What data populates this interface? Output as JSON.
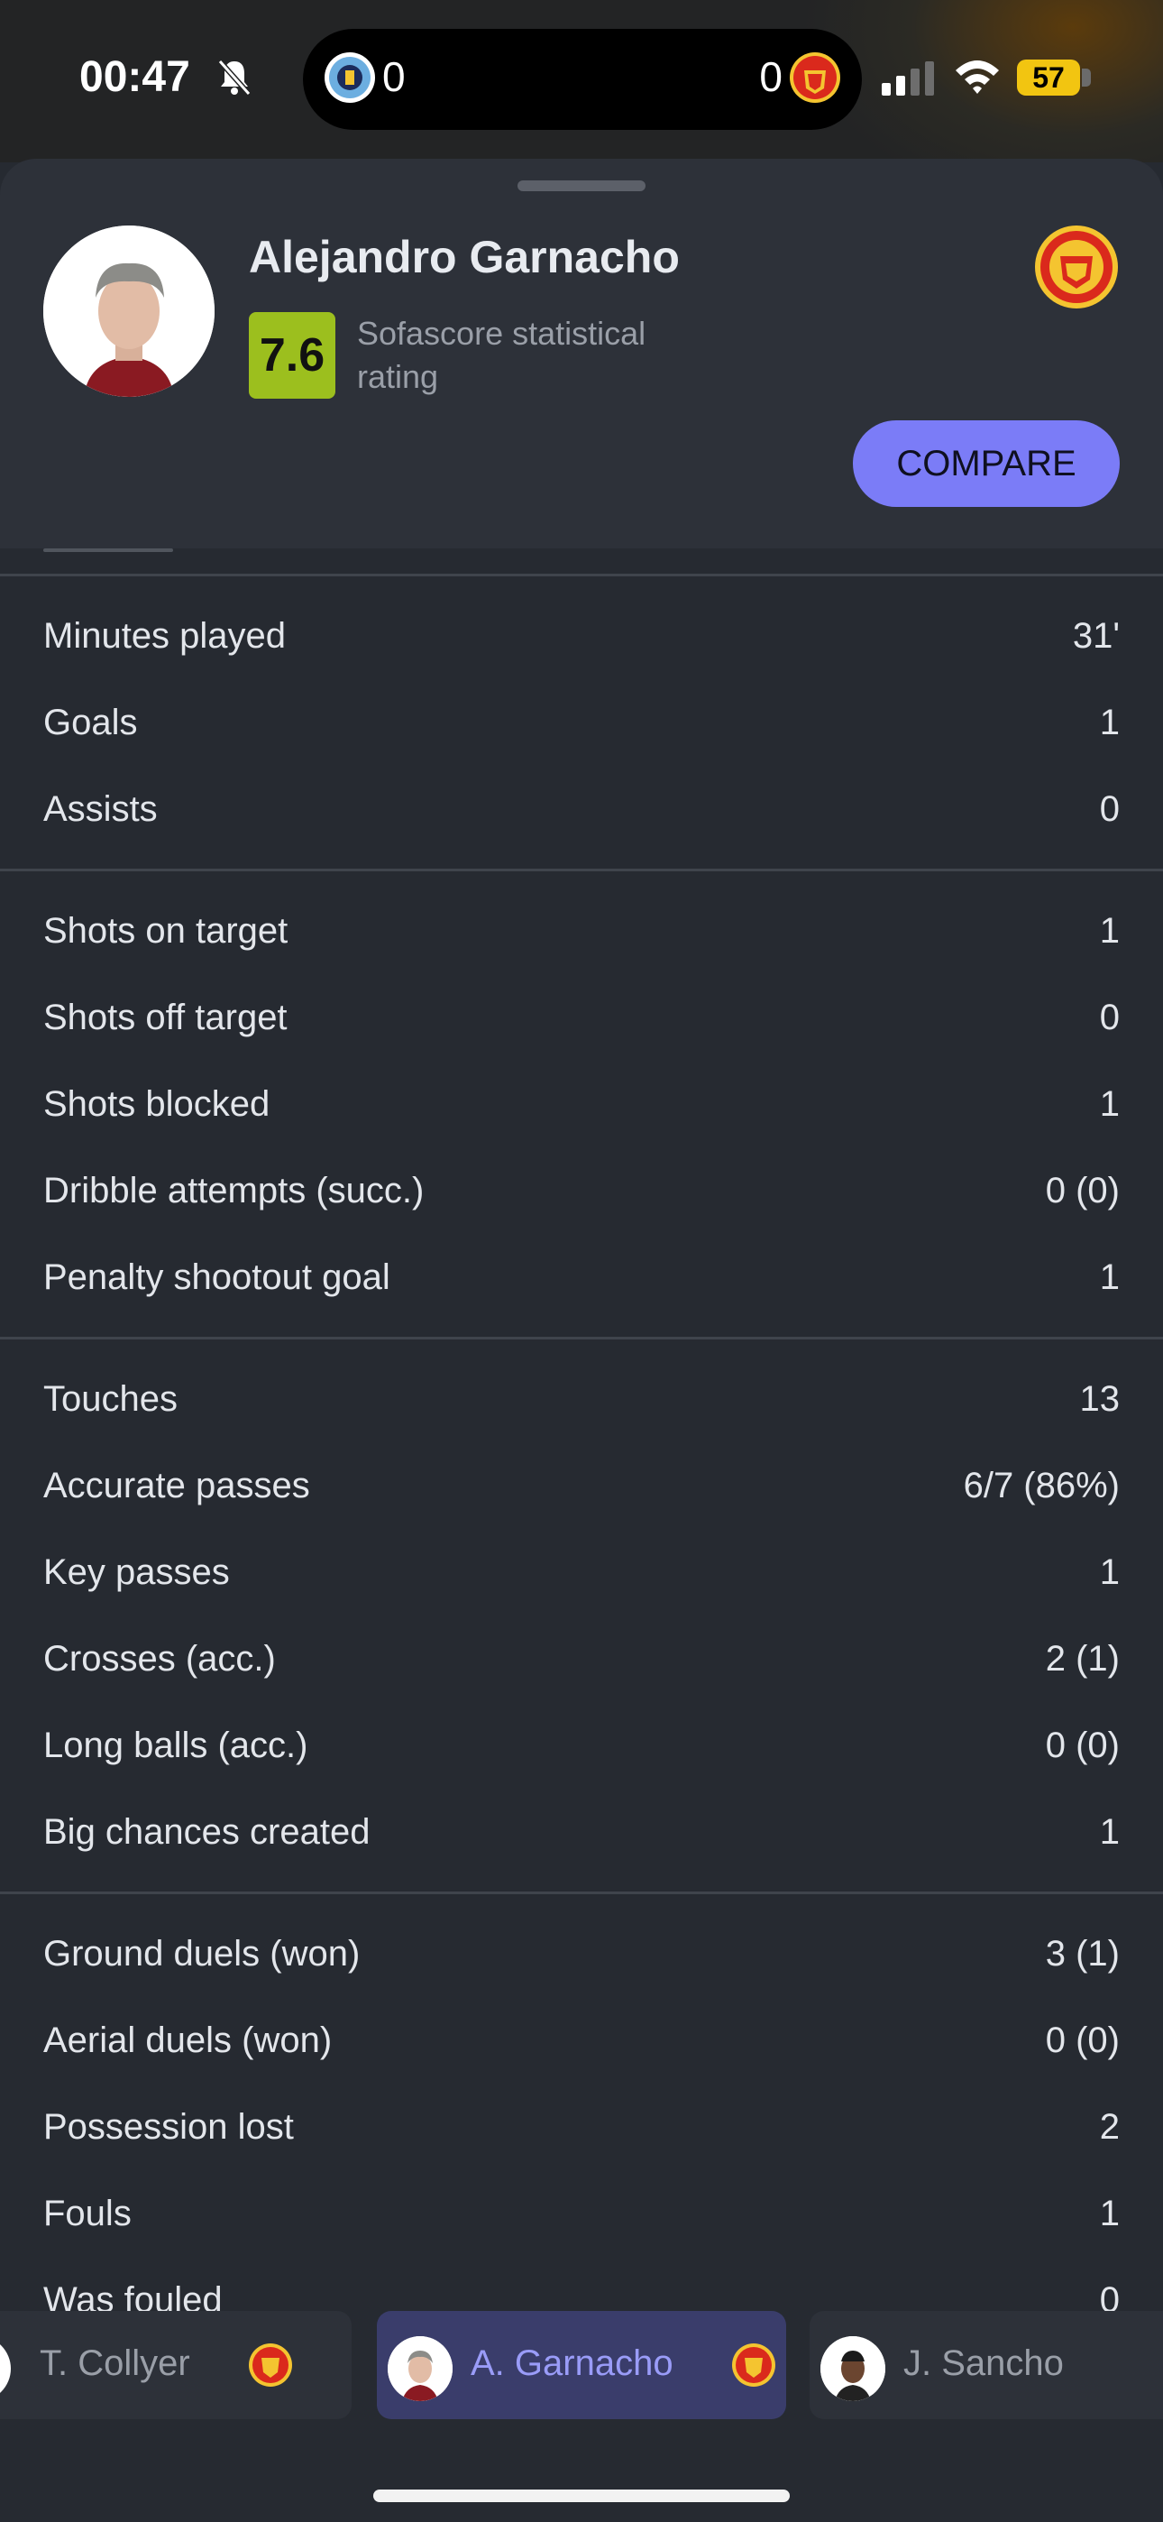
{
  "status_bar": {
    "time": "00:47",
    "home_score": "0",
    "away_score": "0",
    "battery": "57"
  },
  "player": {
    "name": "Alejandro Garnacho",
    "rating": "7.6",
    "rating_caption": "Sofascore statistical rating",
    "compare_label": "COMPARE"
  },
  "stat_groups": [
    [
      {
        "label": "Minutes played",
        "value": "31'"
      },
      {
        "label": "Goals",
        "value": "1"
      },
      {
        "label": "Assists",
        "value": "0"
      }
    ],
    [
      {
        "label": "Shots on target",
        "value": "1"
      },
      {
        "label": "Shots off target",
        "value": "0"
      },
      {
        "label": "Shots blocked",
        "value": "1"
      },
      {
        "label": "Dribble attempts (succ.)",
        "value": "0 (0)"
      },
      {
        "label": "Penalty shootout goal",
        "value": "1"
      }
    ],
    [
      {
        "label": "Touches",
        "value": "13"
      },
      {
        "label": "Accurate passes",
        "value": "6/7 (86%)"
      },
      {
        "label": "Key passes",
        "value": "1"
      },
      {
        "label": "Crosses (acc.)",
        "value": "2 (1)"
      },
      {
        "label": "Long balls (acc.)",
        "value": "0 (0)"
      },
      {
        "label": "Big chances created",
        "value": "1"
      }
    ],
    [
      {
        "label": "Ground duels (won)",
        "value": "3 (1)"
      },
      {
        "label": "Aerial duels (won)",
        "value": "0 (0)"
      },
      {
        "label": "Possession lost",
        "value": "2"
      },
      {
        "label": "Fouls",
        "value": "1"
      },
      {
        "label": "Was fouled",
        "value": "0"
      }
    ]
  ],
  "switcher": {
    "prev": "T. Collyer",
    "current": "A. Garnacho",
    "next": "J. Sancho"
  },
  "colors": {
    "accent": "#7b7cf7",
    "rating_badge": "#9cbf1e",
    "background": "#262a31"
  }
}
